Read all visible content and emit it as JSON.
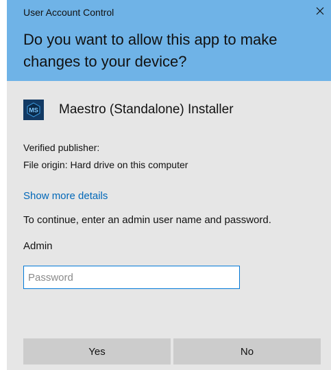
{
  "window": {
    "title": "User Account Control"
  },
  "header": {
    "question": "Do you want to allow this app to make changes to your device?"
  },
  "app": {
    "icon_text": "MS",
    "name": "Maestro (Standalone) Installer"
  },
  "details": {
    "publisher": "Verified publisher:",
    "origin": "File origin: Hard drive on this computer",
    "show_more": "Show more details",
    "continue_text": "To continue, enter an admin user name and password."
  },
  "credentials": {
    "user_label": "Admin",
    "password_placeholder": "Password",
    "password_value": ""
  },
  "buttons": {
    "yes": "Yes",
    "no": "No"
  },
  "colors": {
    "header_bg": "#6fb3e7",
    "body_bg": "#e6e6e6",
    "link": "#0067b8",
    "button_bg": "#cccccc",
    "input_border": "#0078d7",
    "app_icon_bg": "#123a64"
  },
  "icons": {
    "close": "close-icon",
    "app": "maestro-app-icon"
  }
}
